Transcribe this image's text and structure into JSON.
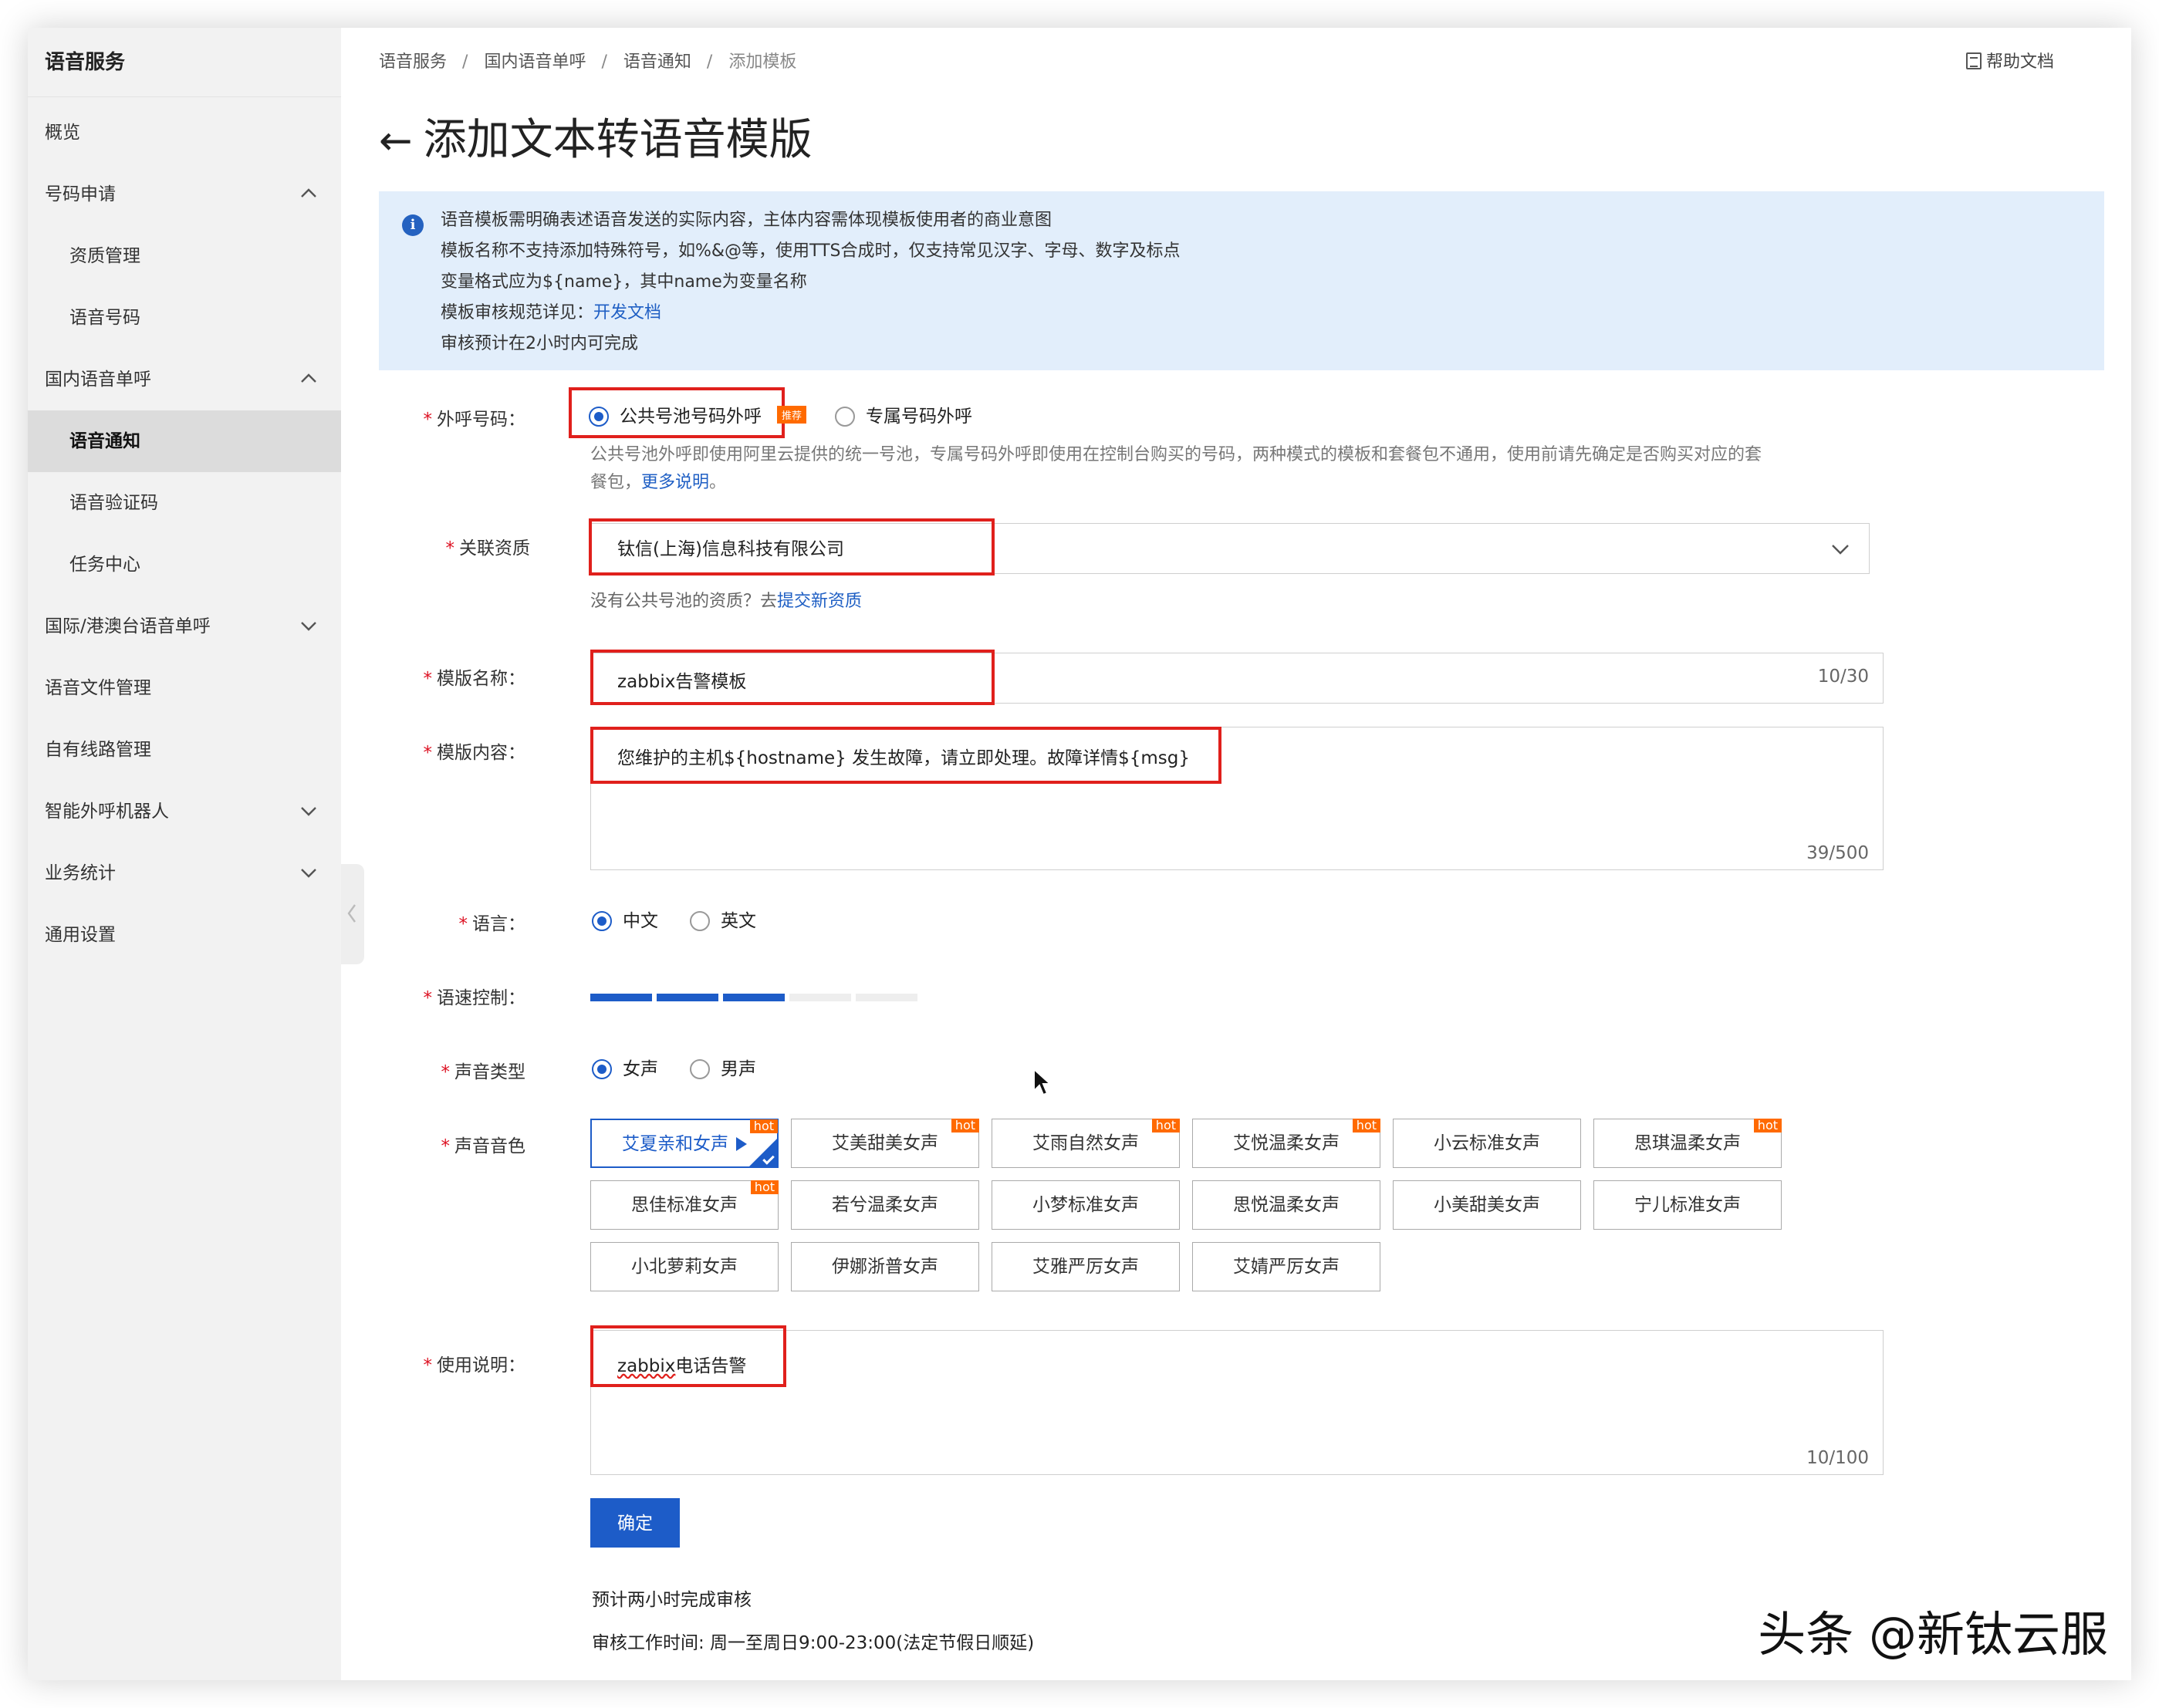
{
  "sidebar": {
    "title": "语音服务",
    "items": [
      {
        "label": "概览"
      },
      {
        "label": "号码申请"
      },
      {
        "label": "资质管理"
      },
      {
        "label": "语音号码"
      },
      {
        "label": "国内语音单呼"
      },
      {
        "label": "语音通知"
      },
      {
        "label": "语音验证码"
      },
      {
        "label": "任务中心"
      },
      {
        "label": "国际/港澳台语音单呼"
      },
      {
        "label": "语音文件管理"
      },
      {
        "label": "自有线路管理"
      },
      {
        "label": "智能外呼机器人"
      },
      {
        "label": "业务统计"
      },
      {
        "label": "通用设置"
      }
    ]
  },
  "breadcrumb": [
    "语音服务",
    "国内语音单呼",
    "语音通知",
    "添加模板"
  ],
  "breadcrumb_sep": "/",
  "help_label": "帮助文档",
  "page_title": "添加文本转语音模版",
  "notice": {
    "lines": [
      "语音模板需明确表述语音发送的实际内容，主体内容需体现模板使用者的商业意图",
      "模板名称不支持添加特殊符号，如%&@等，使用TTS合成时，仅支持常见汉字、字母、数字及标点",
      "变量格式应为${name}，其中name为变量名称",
      "模板审核规范详见："
    ],
    "link": "开发文档",
    "last_line": "审核预计在2小时内可完成"
  },
  "form": {
    "caller": {
      "label": "外呼号码：",
      "option1": "公共号池号码外呼",
      "badge": "推荐",
      "option2": "专属号码外呼",
      "help": "公共号池外呼即使用阿里云提供的统一号池，专属号码外呼即使用在控制台购买的号码，两种模式的模板和套餐包不通用，使用前请先确定是否购买对应的套",
      "help2": "餐包，",
      "help_link": "更多说明",
      "help_end": "。"
    },
    "resource": {
      "label": "关联资质",
      "value": "钛信(上海)信息科技有限公司",
      "help": "没有公共号池的资质？去",
      "help_link": "提交新资质"
    },
    "name": {
      "label": "模版名称：",
      "value": "zabbix告警模板",
      "count": "10/30"
    },
    "content": {
      "label": "模版内容：",
      "value": "您维护的主机${hostname} 发生故障，请立即处理。故障详情${msg}",
      "count": "39/500"
    },
    "language": {
      "label": "语言：",
      "option1": "中文",
      "option2": "英文"
    },
    "speed": {
      "label": "语速控制：",
      "level": 3,
      "max": 5
    },
    "voice_type": {
      "label": "声音类型",
      "option1": "女声",
      "option2": "男声"
    },
    "timbre": {
      "label": "声音音色",
      "hot": "hot",
      "chips": [
        {
          "label": "艾夏亲和女声",
          "hot": true,
          "selected": true
        },
        {
          "label": "艾美甜美女声",
          "hot": true
        },
        {
          "label": "艾雨自然女声",
          "hot": true
        },
        {
          "label": "艾悦温柔女声",
          "hot": true
        },
        {
          "label": "小云标准女声",
          "hot": false
        },
        {
          "label": "思琪温柔女声",
          "hot": true
        },
        {
          "label": "思佳标准女声",
          "hot": true
        },
        {
          "label": "若兮温柔女声",
          "hot": false
        },
        {
          "label": "小梦标准女声",
          "hot": false
        },
        {
          "label": "思悦温柔女声",
          "hot": false
        },
        {
          "label": "小美甜美女声",
          "hot": false
        },
        {
          "label": "宁儿标准女声",
          "hot": false
        },
        {
          "label": "小北萝莉女声",
          "hot": false
        },
        {
          "label": "伊娜浙普女声",
          "hot": false
        },
        {
          "label": "艾雅严厉女声",
          "hot": false
        },
        {
          "label": "艾婧严厉女声",
          "hot": false
        }
      ]
    },
    "usage": {
      "label": "使用说明：",
      "value_a": "zabbix",
      "value_b": "电话告警",
      "count": "10/100"
    },
    "submit": "确定",
    "foot1": "预计两小时完成审核",
    "foot2": "审核工作时间: 周一至周日9:00-23:00(法定节假日顺延)"
  },
  "watermark": "头条 @新钛云服",
  "colors": {
    "accent": "#1d5cc8",
    "highlight": "#e0201c",
    "hot": "#ff6a00"
  }
}
